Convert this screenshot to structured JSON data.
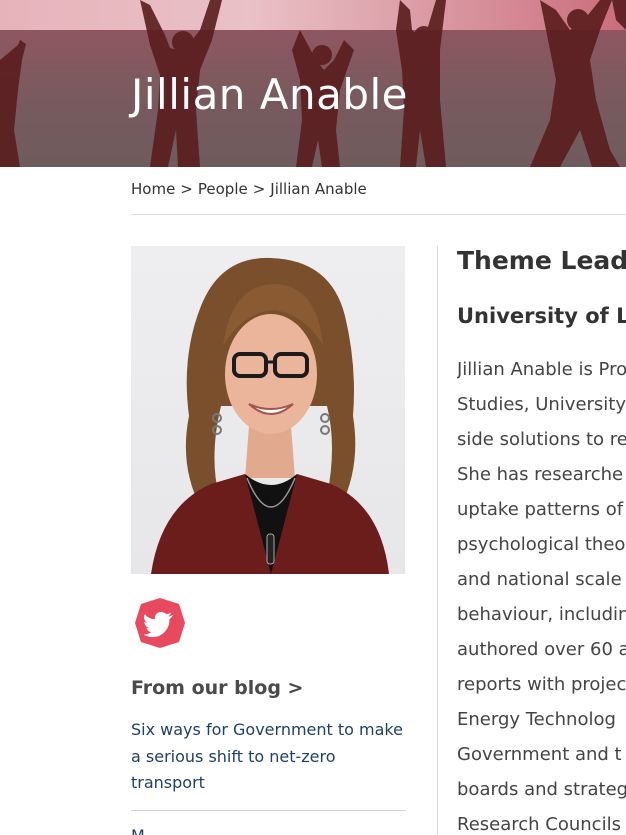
{
  "hero": {
    "title": "Jillian Anable"
  },
  "breadcrumb": {
    "items": [
      "Home",
      "People",
      "Jillian Anable"
    ],
    "separator": ">"
  },
  "sidebar": {
    "photo_alt": "Portrait of Jillian Anable",
    "social": {
      "icon": "twitter-icon",
      "color": "#e8495e"
    },
    "blog_heading": "From our blog >",
    "blog_post_title": "Six ways for Government to make a serious shift to net-zero transport",
    "next_post_partial": "M"
  },
  "profile": {
    "role": "Theme Lead",
    "organisation": "University of Le",
    "bio_lines": [
      "Jillian Anable is Pro",
      "Studies, University",
      "side solutions to re",
      "She has researche",
      "uptake patterns of",
      "psychological theo",
      "and national scale",
      "behaviour, includin",
      "authored over 60 a",
      "reports with projec",
      "Energy Technolog",
      "Government and t",
      "boards and strateg",
      "Research Councils"
    ]
  },
  "colors": {
    "hero_band": "#e7b3bb",
    "hero_body": "#7a5a5e",
    "link": "#1f3f6a",
    "heading": "#333333"
  }
}
